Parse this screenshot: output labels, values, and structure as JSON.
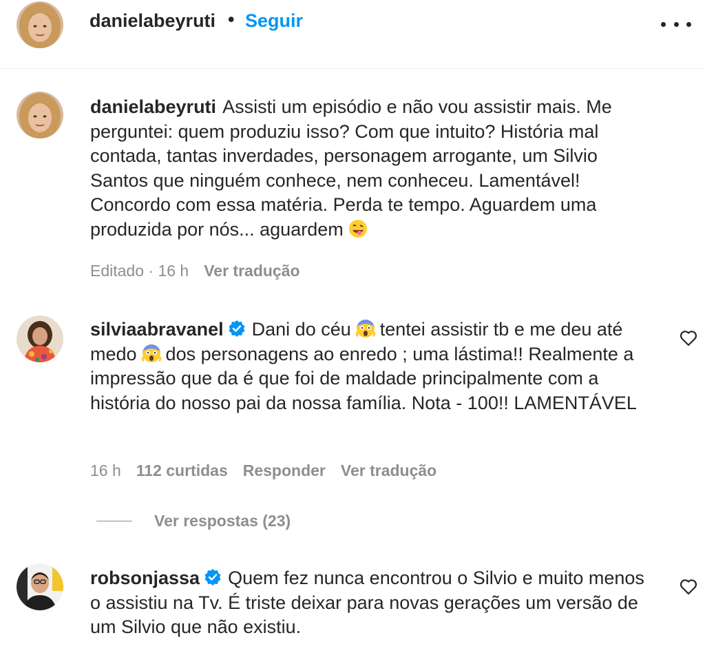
{
  "header": {
    "username": "danielabeyruti",
    "dot": "•",
    "follow_label": "Seguir"
  },
  "comments": [
    {
      "username": "danielabeyruti",
      "verified": false,
      "text_before_emoji": "Assisti um episódio e não vou assistir mais. Me perguntei: quem produziu isso? Com que intuito? História mal contada, tantas inverdades, personagem arrogante, um Silvio Santos que ninguém conhece, nem conheceu. Lamentável! Concordo com essa matéria. Perda te tempo. Aguardem uma produzida por nós... aguardem",
      "emoji": "winking-tongue-face",
      "meta_edited": "Editado · 16 h",
      "meta_translate": "Ver tradução"
    },
    {
      "username": "silviaabravanel",
      "verified": true,
      "text_part1": "Dani do céu",
      "emoji1": "screaming-face",
      "text_part2": "tentei assistir tb e me deu até medo",
      "emoji2": "screaming-face",
      "text_part3": "dos personagens ao enredo ; uma lástima!! Realmente a impressão que da é que foi de maldade principalmente com a história do nosso pai da nossa família. Nota - 100!! LAMENTÁVEL",
      "meta_time": "16 h",
      "meta_likes": "112 curtidas",
      "meta_reply": "Responder",
      "meta_translate": "Ver tradução",
      "view_replies": "Ver respostas (23)"
    },
    {
      "username": "robsonjassa",
      "verified": true,
      "text": "Quem fez nunca encontrou o Silvio e muito menos o assistiu na Tv. É triste deixar para novas gerações um versão de um Silvio que não existiu."
    }
  ],
  "colors": {
    "text": "#262626",
    "muted": "#8e8e8e",
    "link": "#0095f6",
    "verified": "#0095f6",
    "divider": "#efefef"
  }
}
